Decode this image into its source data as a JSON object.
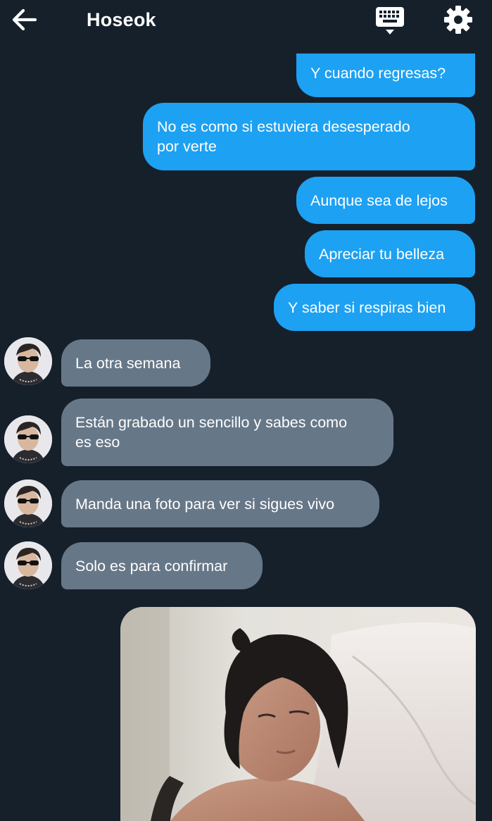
{
  "header": {
    "title": "Hoseok",
    "back_icon": "arrow-left-icon",
    "keyboard_icon": "keyboard-hide-icon",
    "settings_icon": "gear-icon"
  },
  "colors": {
    "background": "#16202b",
    "outgoing_bubble": "#1da1f2",
    "incoming_bubble": "#667788",
    "text": "#ffffff"
  },
  "messages": {
    "out_1": "Y cuando regresas?",
    "out_2_line1": "No es como si estuviera desesperado",
    "out_2_line2": "por verte",
    "out_3": "Aunque sea de lejos",
    "out_4": "Apreciar tu belleza",
    "out_5": "Y saber si respiras bien",
    "in_1": "La otra semana",
    "in_2_line1": "Están grabado un sencillo y sabes como",
    "in_2_line2": "es eso",
    "in_3": "Manda una foto para ver si sigues vivo",
    "in_4": "Solo es para confirmar"
  },
  "photo": {
    "description_icon": "photo-attachment"
  }
}
